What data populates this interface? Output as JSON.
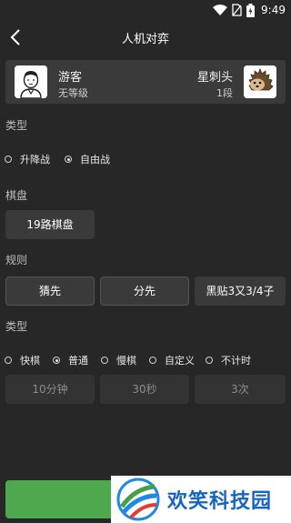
{
  "status": {
    "time": "9:49"
  },
  "header": {
    "title": "人机对弈"
  },
  "players": {
    "guest": {
      "name": "游客",
      "rank": "无等级"
    },
    "ai": {
      "name": "星刺头",
      "rank": "1段"
    }
  },
  "game_type": {
    "label": "类型",
    "options": [
      {
        "label": "升降战",
        "selected": false
      },
      {
        "label": "自由战",
        "selected": true
      }
    ]
  },
  "board": {
    "label": "棋盘",
    "value": "19路棋盘"
  },
  "rules": {
    "label": "规则",
    "buttons": [
      "猜先",
      "分先"
    ],
    "komi": "黑贴3又3/4子"
  },
  "time_type": {
    "label": "类型",
    "options": [
      {
        "label": "快棋",
        "selected": false
      },
      {
        "label": "普通",
        "selected": true
      },
      {
        "label": "慢棋",
        "selected": false
      },
      {
        "label": "自定义",
        "selected": false
      },
      {
        "label": "不计时",
        "selected": false
      }
    ],
    "values": [
      "10分钟",
      "30秒",
      "3次"
    ]
  },
  "watermark": {
    "text": "欢笑科技园"
  },
  "colors": {
    "accent": "#4da84e",
    "background": "#272727",
    "card": "#3a3a3a"
  }
}
